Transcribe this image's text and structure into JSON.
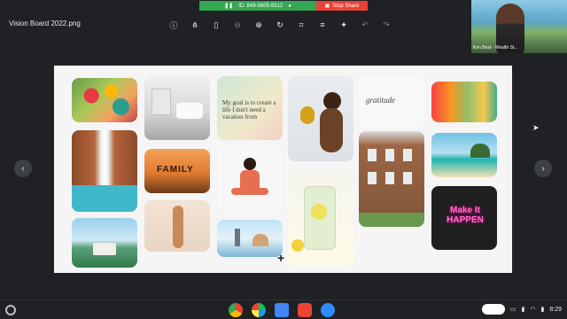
{
  "window": {
    "filename": "Vision Board 2022.png"
  },
  "screen_share": {
    "id_label": "ID: 849-5605-5512",
    "stop_label": "Stop Share"
  },
  "webcam": {
    "name_label": "Ken Best - Wealth St..."
  },
  "toolbar": {
    "icons": [
      "info-icon",
      "share-icon",
      "delete-icon",
      "zoom-out-icon",
      "zoom-in-icon",
      "rotate-icon",
      "crop-icon",
      "adjust-icon",
      "lightbulb-icon",
      "undo-icon",
      "redo-icon"
    ]
  },
  "board": {
    "quote_text": "My goal is to create a life I don't need a vacation from",
    "family_text": "FAMILY",
    "gratitude_text": "gratitude",
    "neon_text": "Make It HAPPEN"
  },
  "taskbar": {
    "time": "8:29"
  },
  "colors": {
    "share_green": "#34a853",
    "stop_red": "#ea4335",
    "background": "#202124"
  }
}
